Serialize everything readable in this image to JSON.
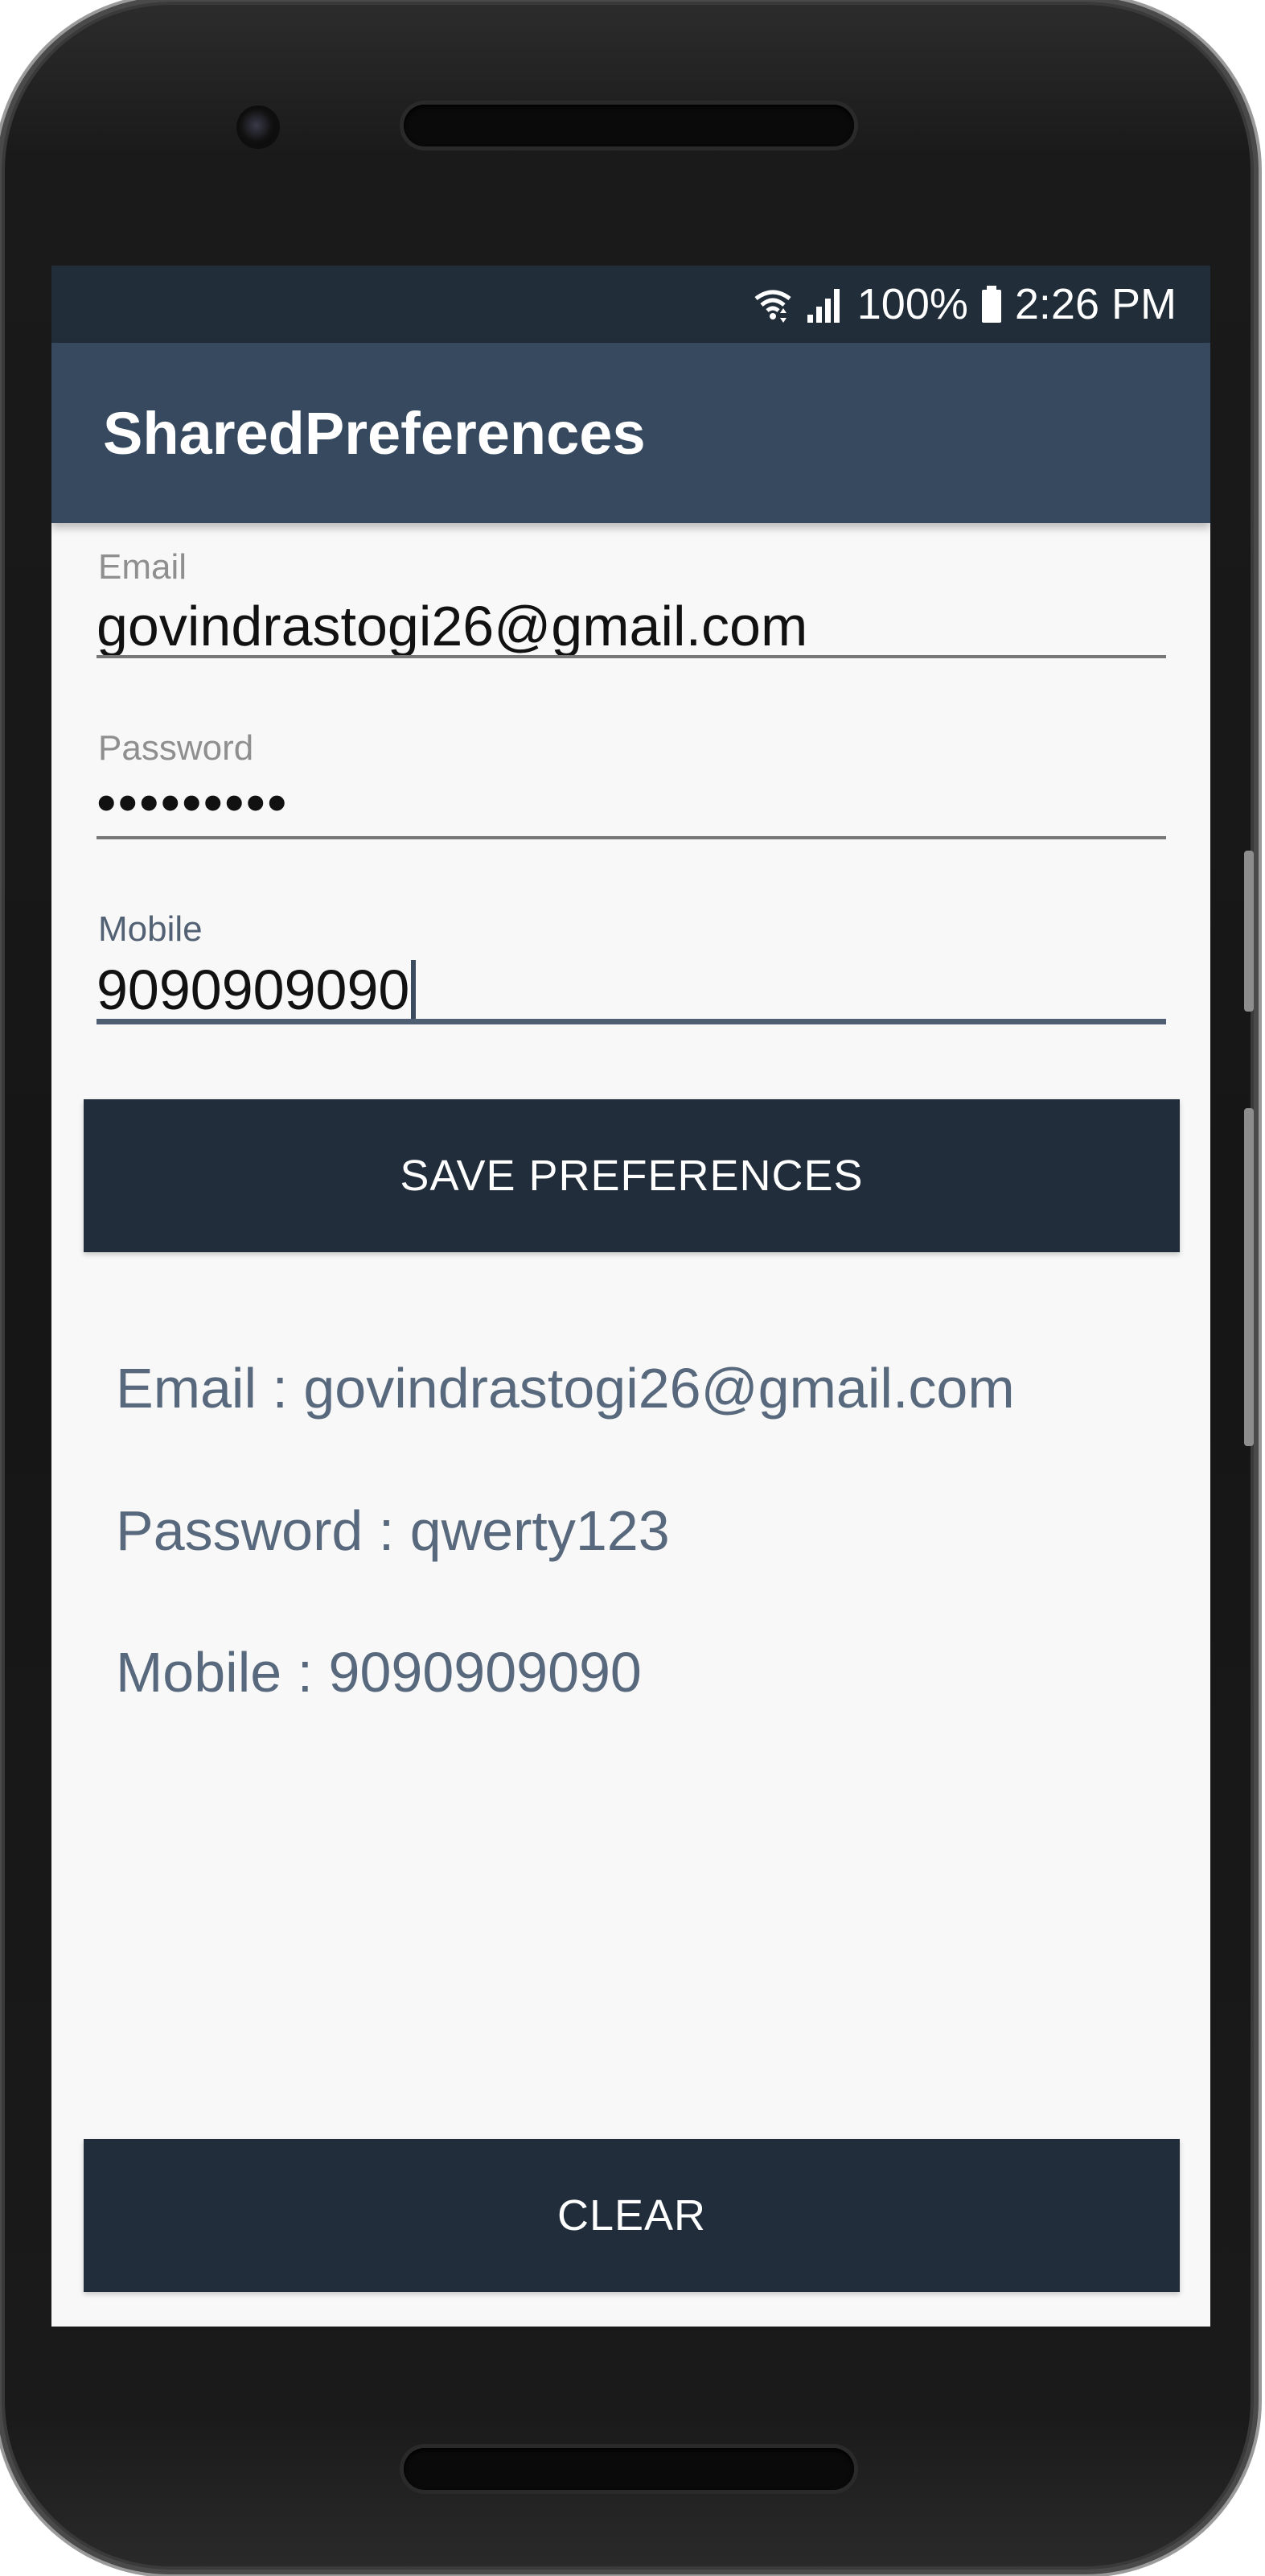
{
  "status_bar": {
    "battery_percent": "100%",
    "time": "2:26 PM",
    "icons": [
      "wifi-icon",
      "signal-icon",
      "battery-icon"
    ]
  },
  "app_bar": {
    "title": "SharedPreferences"
  },
  "form": {
    "email": {
      "label": "Email",
      "value": "govindrastogi26@gmail.com"
    },
    "password": {
      "label": "Password",
      "value": "•••••••••"
    },
    "mobile": {
      "label": "Mobile",
      "value": "9090909090"
    }
  },
  "buttons": {
    "save_label": "SAVE PREFERENCES",
    "clear_label": "CLEAR"
  },
  "saved": {
    "email_line": "Email : govindrastogi26@gmail.com",
    "password_line": "Password : qwerty123",
    "mobile_line": "Mobile : 9090909090"
  },
  "colors": {
    "status_bar": "#212d39",
    "app_bar": "#36495f",
    "button": "#212d3b",
    "saved_text": "#58697e",
    "focus_accent": "#4f5e72"
  }
}
